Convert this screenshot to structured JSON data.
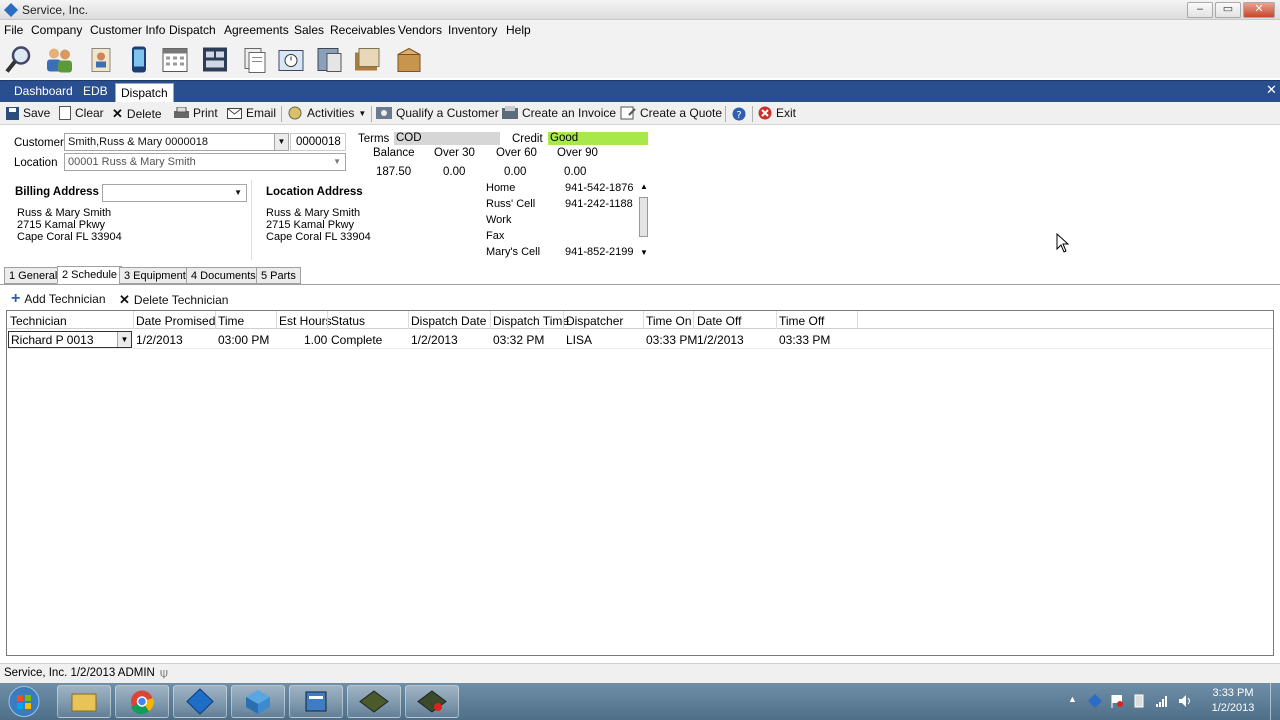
{
  "window": {
    "title": "Service, Inc."
  },
  "menu": [
    "File",
    "Company",
    "Customer Info",
    "Dispatch",
    "Agreements",
    "Sales",
    "Receivables",
    "Vendors",
    "Inventory",
    "Help"
  ],
  "tabs": {
    "dashboard": "Dashboard",
    "edb": "EDB",
    "dispatch": "Dispatch"
  },
  "actions": {
    "save": "Save",
    "clear": "Clear",
    "delete": "Delete",
    "print": "Print",
    "email": "Email",
    "activities": "Activities",
    "qualify": "Qualify a Customer",
    "invoice": "Create an Invoice",
    "quote": "Create a Quote",
    "exit": "Exit"
  },
  "customer": {
    "label": "Customer",
    "value": "Smith,Russ & Mary 0000018",
    "id": "0000018",
    "location_label": "Location",
    "location": "00001 Russ & Mary Smith"
  },
  "account": {
    "terms_label": "Terms",
    "terms": "COD",
    "credit_label": "Credit",
    "credit": "Good",
    "balance_label": "Balance",
    "over30_label": "Over 30",
    "over60_label": "Over 60",
    "over90_label": "Over 90",
    "balance": "187.50",
    "over30": "0.00",
    "over60": "0.00",
    "over90": "0.00",
    "credit_color": "#a8e84a"
  },
  "billing": {
    "label": "Billing Address",
    "line1": "Russ & Mary Smith",
    "line2": "2715 Kamal Pkwy",
    "line3": "Cape Coral FL  33904"
  },
  "location_address": {
    "label": "Location Address",
    "line1": "Russ & Mary Smith",
    "line2": "2715 Kamal Pkwy",
    "line3": "Cape Coral FL  33904"
  },
  "phones": [
    {
      "type": "Home",
      "number": "941-542-1876"
    },
    {
      "type": "Russ' Cell",
      "number": "941-242-1188"
    },
    {
      "type": "Work",
      "number": ""
    },
    {
      "type": "Fax",
      "number": ""
    },
    {
      "type": "Mary's Cell",
      "number": "941-852-2199"
    }
  ],
  "subtabs": [
    "1 General",
    "2 Schedule",
    "3 Equipment",
    "4 Documents",
    "5 Parts"
  ],
  "schedule": {
    "add_tech": "Add Technician",
    "delete_tech": "Delete Technician",
    "columns": [
      "Technician",
      "Date Promised",
      "Time",
      "Est Hours",
      "Status",
      "Dispatch Date",
      "Dispatch Time",
      "Dispatcher",
      "Time On",
      "Date Off",
      "Time Off"
    ],
    "rows": [
      [
        "Richard P 0013",
        "1/2/2013",
        "03:00 PM",
        "1.00",
        "Complete",
        "1/2/2013",
        "03:32 PM",
        "LISA",
        "03:33 PM",
        "1/2/2013",
        "03:33 PM"
      ]
    ]
  },
  "status": {
    "text": "Service, Inc.  1/2/2013  ADMIN"
  },
  "clock": {
    "time": "3:33 PM",
    "date": "1/2/2013"
  }
}
